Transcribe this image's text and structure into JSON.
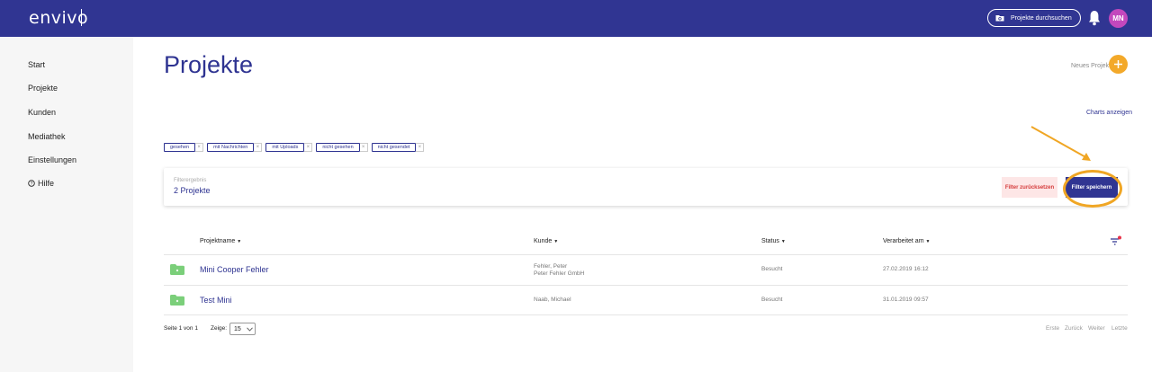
{
  "header": {
    "logo": "envivo",
    "search_label": "Projekte durchsuchen",
    "avatar_initials": "MN",
    "brand_color": "#303592",
    "avatar_color": "#c348bd"
  },
  "sidebar": {
    "items": [
      {
        "label": "Start"
      },
      {
        "label": "Projekte"
      },
      {
        "label": "Kunden"
      },
      {
        "label": "Mediathek"
      },
      {
        "label": "Einstellungen"
      },
      {
        "label": "Hilfe",
        "icon": "help-circle-icon"
      }
    ]
  },
  "main": {
    "title": "Projekte",
    "new_project_label": "Neues Projekt",
    "new_project_color": "#f3a92a",
    "charts_link": "Charts anzeigen"
  },
  "chips": [
    {
      "label": "gesehen"
    },
    {
      "label": "mit Nachrichten"
    },
    {
      "label": "mit Uploads"
    },
    {
      "label": "nicht gesehen"
    },
    {
      "label": "nicht gesendet"
    }
  ],
  "chip_remove": "×",
  "filter": {
    "label": "Filterergebnis",
    "count": "2 Projekte",
    "reset_label": "Filter zurücksetzen",
    "save_label": "Filter speichern",
    "highlight_color": "#f0a624"
  },
  "table": {
    "columns": {
      "name": "Projektname",
      "customer": "Kunde",
      "status": "Status",
      "edited": "Verarbeitet am"
    },
    "sort_caret": "▼",
    "rows": [
      {
        "name": "Mini Cooper Fehler",
        "customer_line1": "Fehler, Peter",
        "customer_line2": "Peter Fehler GmbH",
        "status": "Besucht",
        "edited": "27.02.2019 16:12"
      },
      {
        "name": "Test Mini",
        "customer_line1": "Naab, Michael",
        "customer_line2": "",
        "status": "Besucht",
        "edited": "31.01.2019 09:57"
      }
    ],
    "folder_color": "#7bcf7a"
  },
  "pagination": {
    "info": "Seite 1 von 1",
    "show_label": "Zeige:",
    "per_page": "15",
    "first": "Erste",
    "prev": "Zurück",
    "next": "Weiter",
    "last": "Letzte"
  }
}
